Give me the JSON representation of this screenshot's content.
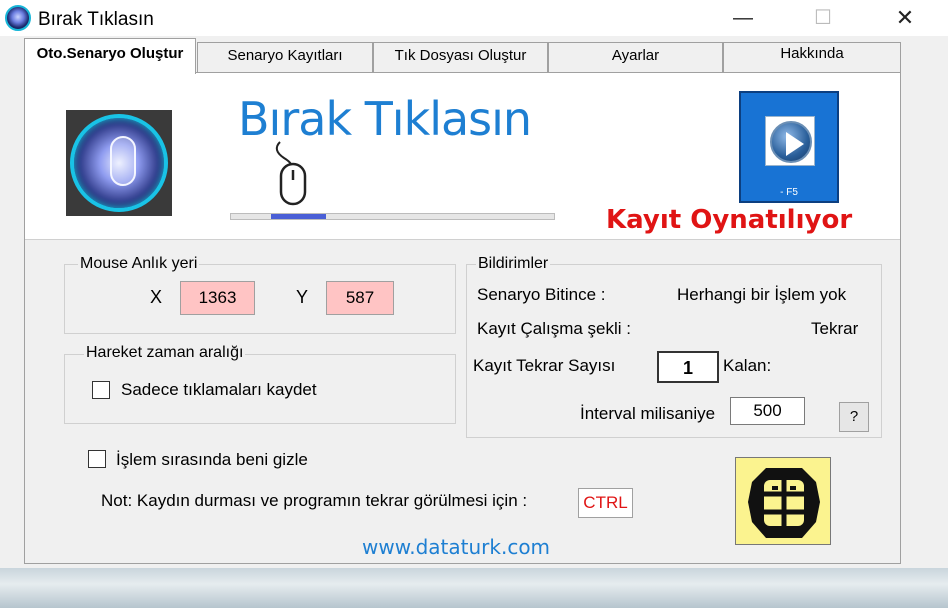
{
  "window": {
    "title": "Bırak Tıklasın",
    "controls": {
      "minimize": "—",
      "maximize": "☐",
      "close": "✕"
    }
  },
  "tabs": [
    {
      "label": "Oto.Senaryo Oluştur",
      "active": true
    },
    {
      "label": "Senaryo Kayıtları",
      "active": false
    },
    {
      "label": "Tık Dosyası Oluştur",
      "active": false
    },
    {
      "label": "Ayarlar",
      "active": false
    },
    {
      "label": "Hakkında",
      "active": false
    }
  ],
  "header": {
    "app_name": "Bırak Tıklasın",
    "progress_fraction": 0.17,
    "play_button": {
      "shortcut_label": "- F5",
      "icon": "play-icon"
    },
    "status": "Kayıt Oynatılıyor",
    "colors": {
      "title": "#1e7fd2",
      "status": "#e01414",
      "play_bg": "#1873d4"
    }
  },
  "mouse_position": {
    "group_title": "Mouse Anlık yeri",
    "x_label": "X",
    "x_value": "1363",
    "y_label": "Y",
    "y_value": "587"
  },
  "interval_group": {
    "group_title": "Hareket zaman aralığı",
    "only_clicks_label": "Sadece tıklamaları kaydet",
    "only_clicks_checked": false
  },
  "notifications": {
    "group_title": "Bildirimler",
    "scenario_end_label": "Senaryo Bitince :",
    "scenario_end_value": "Herhangi bir İşlem yok",
    "run_mode_label": "Kayıt Çalışma şekli :",
    "run_mode_value": "Tekrar",
    "repeat_count_label": "Kayıt Tekrar Sayısı",
    "repeat_count_value": "1",
    "remaining_label": "Kalan:",
    "interval_label": "İnterval milisaniye",
    "interval_value": "500",
    "help_label": "?"
  },
  "hide_option": {
    "label": "İşlem sırasında beni gizle",
    "checked": false
  },
  "note": {
    "text": "Not: Kaydın durması ve programın tekrar görülmesi için :",
    "key": "CTRL"
  },
  "website": "www.dataturk.com"
}
